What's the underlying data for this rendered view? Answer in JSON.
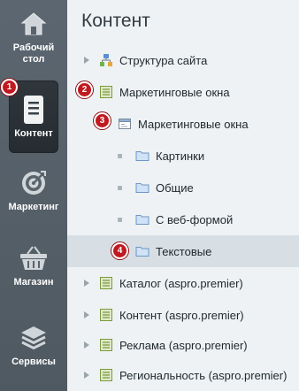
{
  "sidebar": {
    "items": [
      {
        "label_line1": "Рабочий",
        "label_line2": "стол",
        "icon": "home-icon"
      },
      {
        "label": "Контент",
        "icon": "document-icon",
        "badge": "1"
      },
      {
        "label": "Маркетинг",
        "icon": "target-icon"
      },
      {
        "label": "Магазин",
        "icon": "basket-icon"
      },
      {
        "label": "Сервисы",
        "icon": "layers-icon"
      }
    ]
  },
  "main": {
    "title": "Контент",
    "tree": [
      {
        "label": "Структура сайта"
      },
      {
        "label": "Маркетинговые окна",
        "badge": "2"
      },
      {
        "label": "Маркетинговые окна",
        "badge": "3"
      },
      {
        "label": "Картинки"
      },
      {
        "label": "Общие"
      },
      {
        "label": "С веб-формой"
      },
      {
        "label": "Текстовые",
        "badge": "4"
      },
      {
        "label": "Каталог (aspro.premier)"
      },
      {
        "label": "Контент (aspro.premier)"
      },
      {
        "label": "Реклама (aspro.premier)"
      },
      {
        "label": "Региональность (aspro.premier)"
      }
    ]
  },
  "colors": {
    "badge": "#c0191f",
    "rail": "#545e67",
    "panel": "#eef2f4",
    "selected": "#d7dfe4"
  }
}
